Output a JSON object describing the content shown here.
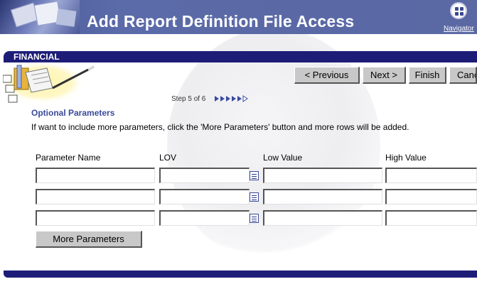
{
  "header": {
    "title": "Add Report Definition File Access",
    "navigator_label": "Navigator"
  },
  "section_band": {
    "label": "FINANCIAL"
  },
  "wizard": {
    "previous_label": "< Previous",
    "next_label": "Next >",
    "finish_label": "Finish",
    "cancel_label": "Cancel",
    "step_text": "Step 5 of 6"
  },
  "optional_parameters": {
    "title": "Optional Parameters",
    "instructions": "If want to include more parameters, click the 'More Parameters' button and more rows will be added.",
    "columns": [
      "Parameter Name",
      "LOV",
      "Low Value",
      "High Value"
    ],
    "rows": [
      {
        "parameter_name": "",
        "lov": "",
        "low_value": "",
        "high_value": ""
      },
      {
        "parameter_name": "",
        "lov": "",
        "low_value": "",
        "high_value": ""
      },
      {
        "parameter_name": "",
        "lov": "",
        "low_value": "",
        "high_value": ""
      }
    ],
    "more_parameters_label": "More Parameters"
  },
  "colors": {
    "band": "#1d1d78",
    "header": "#5b6aa8",
    "section_title": "#3a4a9a",
    "button_face": "#c8c8c8"
  },
  "icons": {
    "lov": "list-icon",
    "navigator": "navigator-icon",
    "step_progress": "step-arrows-icon"
  }
}
